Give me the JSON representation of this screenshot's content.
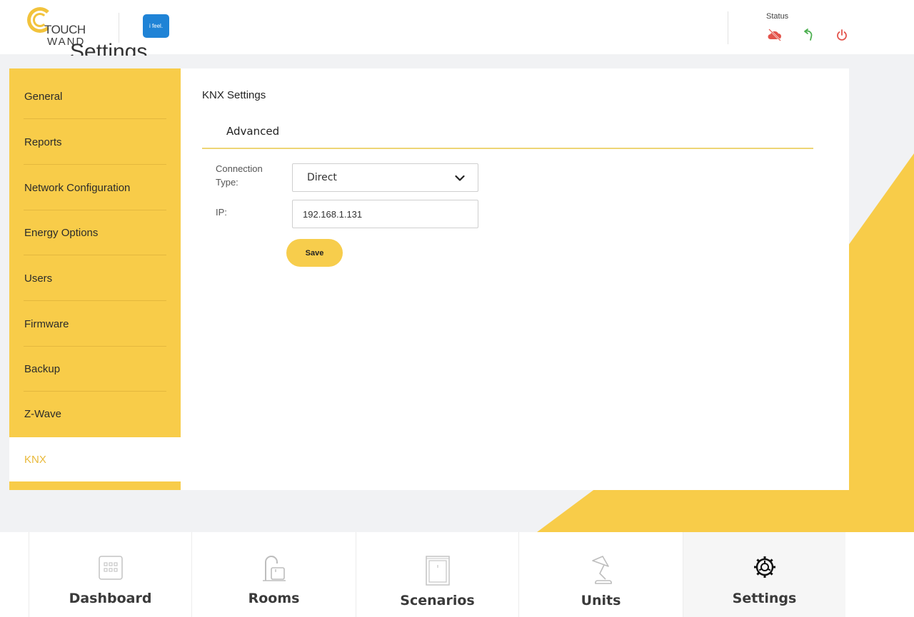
{
  "header": {
    "logo_top": "TOUCH",
    "logo_bottom": "WAND",
    "partner_logo": "i feel.",
    "status_label": "Status",
    "status_icons": [
      "cloud-off-icon",
      "undo-icon",
      "power-icon"
    ],
    "colors": {
      "cloud_off": "#e3534b",
      "undo": "#4caf50",
      "power": "#e3534b"
    }
  },
  "page": {
    "partial_title": "Settings"
  },
  "sidebar": {
    "items": [
      {
        "label": "General",
        "active": false
      },
      {
        "label": "Reports",
        "active": false
      },
      {
        "label": "Network Configuration",
        "active": false
      },
      {
        "label": "Energy Options",
        "active": false
      },
      {
        "label": "Users",
        "active": false
      },
      {
        "label": "Firmware",
        "active": false
      },
      {
        "label": "Backup",
        "active": false
      },
      {
        "label": "Z-Wave",
        "active": false
      },
      {
        "label": "KNX",
        "active": true
      }
    ]
  },
  "main": {
    "title": "KNX Settings",
    "tabs": [
      {
        "label": "Advanced",
        "active": true
      }
    ],
    "form": {
      "connection_type_label_1": "Connection",
      "connection_type_label_2": "Type:",
      "connection_type_value": "Direct",
      "ip_label": "IP:",
      "ip_value": "192.168.1.131",
      "save_label": "Save"
    }
  },
  "bottom_nav": {
    "items": [
      {
        "label": "Dashboard",
        "icon": "dashboard-icon",
        "active": false
      },
      {
        "label": "Rooms",
        "icon": "rooms-icon",
        "active": false
      },
      {
        "label": "Scenarios",
        "icon": "scenarios-icon",
        "active": false
      },
      {
        "label": "Units",
        "icon": "lamp-icon",
        "active": false
      },
      {
        "label": "Settings",
        "icon": "gear-icon",
        "active": true
      }
    ]
  },
  "colors": {
    "accent": "#f8cc49",
    "active_text": "#e9b93a",
    "backdrop": "#f1f2f4"
  }
}
